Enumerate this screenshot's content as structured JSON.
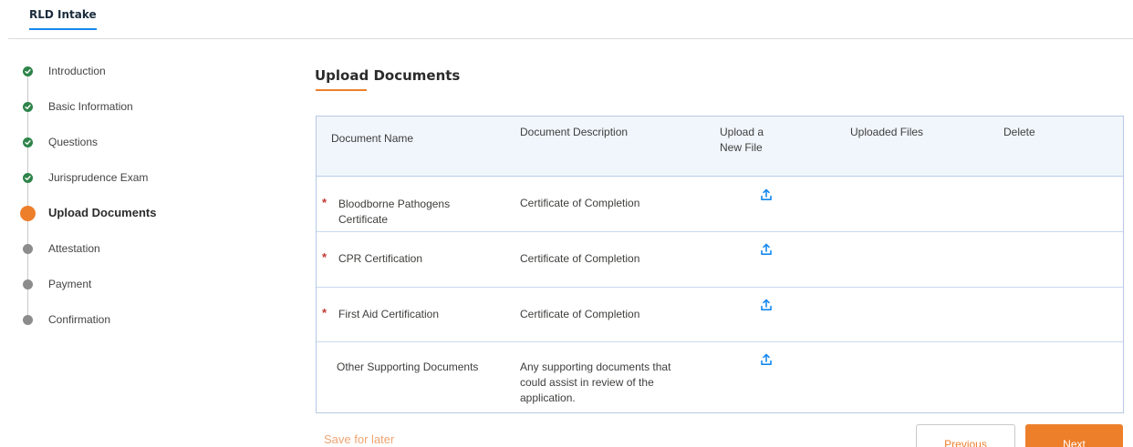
{
  "app": {
    "tab_label": "RLD Intake"
  },
  "colors": {
    "accent": "#ed7f2b",
    "complete": "#2e844a",
    "pending": "#8c8c8c",
    "link_blue": "#1589ee",
    "required": "#c23934"
  },
  "steps": [
    {
      "label": "Introduction",
      "status": "complete"
    },
    {
      "label": "Basic Information",
      "status": "complete"
    },
    {
      "label": "Questions",
      "status": "complete"
    },
    {
      "label": "Jurisprudence Exam",
      "status": "complete"
    },
    {
      "label": "Upload Documents",
      "status": "current"
    },
    {
      "label": "Attestation",
      "status": "pending"
    },
    {
      "label": "Payment",
      "status": "pending"
    },
    {
      "label": "Confirmation",
      "status": "pending"
    }
  ],
  "main": {
    "title": "Upload Documents"
  },
  "table": {
    "headers": {
      "name": "Document Name",
      "description": "Document Description",
      "upload_line1": "Upload a",
      "upload_line2": "New File",
      "uploaded": "Uploaded Files",
      "delete": "Delete"
    },
    "required_marker": "*",
    "rows": [
      {
        "name_line1": "Bloodborne Pathogens",
        "name_line2": "Certificate",
        "description_line1": "Certificate of Completion",
        "description_line2": "",
        "description_line3": "",
        "required": true,
        "upload_icon": "upload-icon"
      },
      {
        "name_line1": "CPR Certification",
        "name_line2": "",
        "description_line1": "Certificate of Completion",
        "description_line2": "",
        "description_line3": "",
        "required": true,
        "upload_icon": "upload-icon"
      },
      {
        "name_line1": "First Aid Certification",
        "name_line2": "",
        "description_line1": "Certificate of Completion",
        "description_line2": "",
        "description_line3": "",
        "required": true,
        "upload_icon": "upload-icon"
      },
      {
        "name_line1": "Other Supporting Documents",
        "name_line2": "",
        "description_line1": "Any supporting documents that",
        "description_line2": "could assist in review of the",
        "description_line3": "application.",
        "required": false,
        "upload_icon": "upload-icon"
      }
    ]
  },
  "footer": {
    "save_label": "Save for later",
    "previous_label": "Previous",
    "next_label": "Next"
  }
}
